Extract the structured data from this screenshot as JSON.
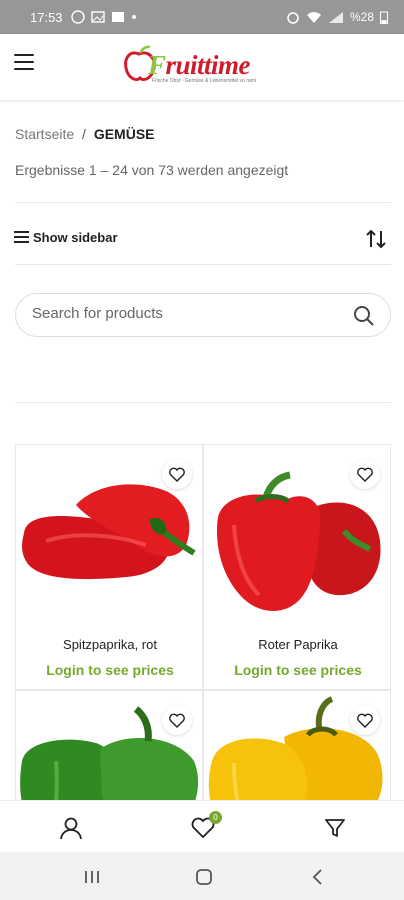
{
  "status_bar": {
    "time": "17:53",
    "battery": "%28"
  },
  "header": {
    "brand_prefix": "F",
    "brand_rest": "ruittime",
    "tagline": "Frische Obst - Gemüse & Lebensmittel vo rami"
  },
  "breadcrumb": {
    "home": "Startseite",
    "separator": "/",
    "current": "GEMÜSE"
  },
  "results_text": "Ergebnisse 1 – 24 von 73 werden angezeigt",
  "toolbar": {
    "show_sidebar": "Show sidebar"
  },
  "search": {
    "placeholder": "Search for products"
  },
  "products": [
    {
      "name": "Spitzpaprika, rot",
      "price_text": "Login to see prices"
    },
    {
      "name": "Roter Paprika",
      "price_text": "Login to see prices"
    },
    {
      "name": "",
      "price_text": ""
    },
    {
      "name": "",
      "price_text": ""
    }
  ],
  "bottom_nav": {
    "wishlist_count": "0"
  },
  "colors": {
    "brand_red": "#d21b2a",
    "accent_green": "#77a82e"
  }
}
